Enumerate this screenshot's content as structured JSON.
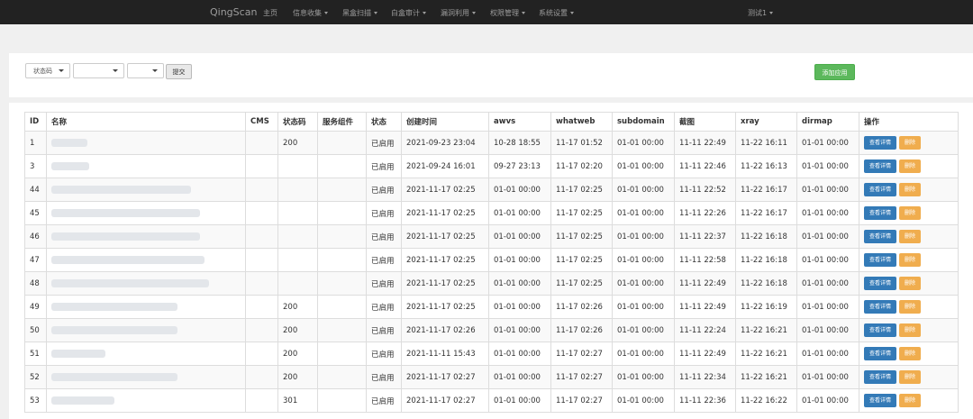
{
  "navbar": {
    "brand": "QingScan",
    "items": [
      "主页",
      "信息收集",
      "黑盒扫描",
      "白盒审计",
      "漏洞利用",
      "权限管理",
      "系统设置"
    ],
    "user": "测试1"
  },
  "filter": {
    "status_select": "状态码",
    "select2": "",
    "select3": "",
    "submit_label": "提交"
  },
  "add_button_label": "添加应用",
  "table": {
    "headers": [
      "ID",
      "名称",
      "CMS",
      "状态码",
      "服务组件",
      "状态",
      "创建时间",
      "awvs",
      "whatweb",
      "subdomain",
      "截图",
      "xray",
      "dirmap",
      "操作"
    ],
    "view_label": "查看详情",
    "delete_label": "删除",
    "rows": [
      {
        "id": "1",
        "cms": "",
        "code": "200",
        "service": "",
        "state": "已启用",
        "created": "2021-09-23 23:04",
        "awvs": "10-28 18:55",
        "whatweb": "11-17 01:52",
        "subdomain": "01-01 00:00",
        "shot": "11-11 22:49",
        "xray": "11-22 16:11",
        "dirmap": "01-01 00:00"
      },
      {
        "id": "3",
        "cms": "",
        "code": "",
        "service": "",
        "state": "已启用",
        "created": "2021-09-24 16:01",
        "awvs": "09-27 23:13",
        "whatweb": "11-17 02:20",
        "subdomain": "01-01 00:00",
        "shot": "11-11 22:46",
        "xray": "11-22 16:13",
        "dirmap": "01-01 00:00"
      },
      {
        "id": "44",
        "cms": "",
        "code": "",
        "service": "",
        "state": "已启用",
        "created": "2021-11-17 02:25",
        "awvs": "01-01 00:00",
        "whatweb": "11-17 02:25",
        "subdomain": "01-01 00:00",
        "shot": "11-11 22:52",
        "xray": "11-22 16:17",
        "dirmap": "01-01 00:00"
      },
      {
        "id": "45",
        "cms": "",
        "code": "",
        "service": "",
        "state": "已启用",
        "created": "2021-11-17 02:25",
        "awvs": "01-01 00:00",
        "whatweb": "11-17 02:25",
        "subdomain": "01-01 00:00",
        "shot": "11-11 22:26",
        "xray": "11-22 16:17",
        "dirmap": "01-01 00:00"
      },
      {
        "id": "46",
        "cms": "",
        "code": "",
        "service": "",
        "state": "已启用",
        "created": "2021-11-17 02:25",
        "awvs": "01-01 00:00",
        "whatweb": "11-17 02:25",
        "subdomain": "01-01 00:00",
        "shot": "11-11 22:37",
        "xray": "11-22 16:18",
        "dirmap": "01-01 00:00"
      },
      {
        "id": "47",
        "cms": "",
        "code": "",
        "service": "",
        "state": "已启用",
        "created": "2021-11-17 02:25",
        "awvs": "01-01 00:00",
        "whatweb": "11-17 02:25",
        "subdomain": "01-01 00:00",
        "shot": "11-11 22:58",
        "xray": "11-22 16:18",
        "dirmap": "01-01 00:00"
      },
      {
        "id": "48",
        "cms": "",
        "code": "",
        "service": "",
        "state": "已启用",
        "created": "2021-11-17 02:25",
        "awvs": "01-01 00:00",
        "whatweb": "11-17 02:25",
        "subdomain": "01-01 00:00",
        "shot": "11-11 22:49",
        "xray": "11-22 16:18",
        "dirmap": "01-01 00:00"
      },
      {
        "id": "49",
        "cms": "",
        "code": "200",
        "service": "",
        "state": "已启用",
        "created": "2021-11-17 02:25",
        "awvs": "01-01 00:00",
        "whatweb": "11-17 02:26",
        "subdomain": "01-01 00:00",
        "shot": "11-11 22:49",
        "xray": "11-22 16:19",
        "dirmap": "01-01 00:00"
      },
      {
        "id": "50",
        "cms": "",
        "code": "200",
        "service": "",
        "state": "已启用",
        "created": "2021-11-17 02:26",
        "awvs": "01-01 00:00",
        "whatweb": "11-17 02:26",
        "subdomain": "01-01 00:00",
        "shot": "11-11 22:24",
        "xray": "11-22 16:21",
        "dirmap": "01-01 00:00"
      },
      {
        "id": "51",
        "cms": "",
        "code": "200",
        "service": "",
        "state": "已启用",
        "created": "2021-11-11 15:43",
        "awvs": "01-01 00:00",
        "whatweb": "11-17 02:27",
        "subdomain": "01-01 00:00",
        "shot": "11-11 22:49",
        "xray": "11-22 16:21",
        "dirmap": "01-01 00:00"
      },
      {
        "id": "52",
        "cms": "",
        "code": "200",
        "service": "",
        "state": "已启用",
        "created": "2021-11-17 02:27",
        "awvs": "01-01 00:00",
        "whatweb": "11-17 02:27",
        "subdomain": "01-01 00:00",
        "shot": "11-11 22:34",
        "xray": "11-22 16:21",
        "dirmap": "01-01 00:00"
      },
      {
        "id": "53",
        "cms": "",
        "code": "301",
        "service": "",
        "state": "已启用",
        "created": "2021-11-17 02:27",
        "awvs": "01-01 00:00",
        "whatweb": "11-17 02:27",
        "subdomain": "01-01 00:00",
        "shot": "11-11 22:36",
        "xray": "11-22 16:22",
        "dirmap": "01-01 00:00"
      }
    ]
  }
}
